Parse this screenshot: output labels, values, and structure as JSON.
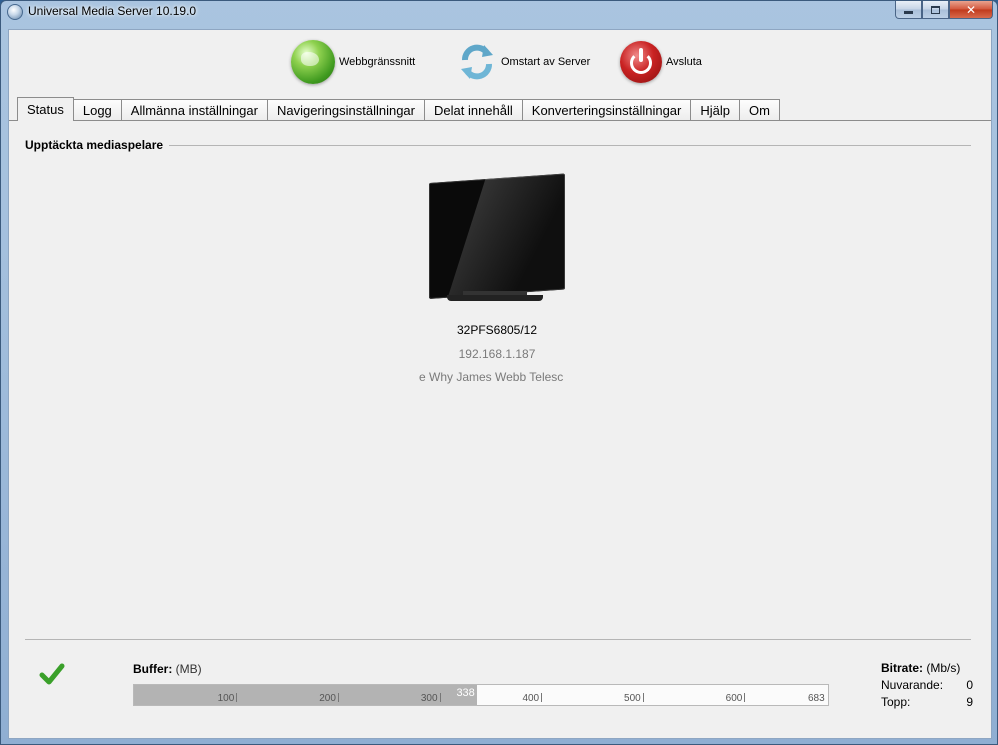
{
  "window": {
    "title": "Universal Media Server 10.19.0",
    "minimize": "minimize",
    "maximize": "maximize",
    "close": "✕"
  },
  "toolbar": {
    "web_label": "Webbgränssnitt",
    "restart_label": "Omstart av Server",
    "quit_label": "Avsluta"
  },
  "tabs": [
    {
      "label": "Status",
      "active": true
    },
    {
      "label": "Logg"
    },
    {
      "label": "Allmänna inställningar"
    },
    {
      "label": "Navigeringsinställningar"
    },
    {
      "label": "Delat innehåll"
    },
    {
      "label": "Konverteringsinställningar"
    },
    {
      "label": "Hjälp"
    },
    {
      "label": "Om"
    }
  ],
  "status": {
    "section_title": "Upptäckta mediaspelare",
    "renderer": {
      "name": "32PFS6805/12",
      "ip": "192.168.1.187",
      "playing": "e   Why James Webb Telesc"
    },
    "buffer": {
      "label": "Buffer:",
      "unit": "(MB)",
      "value": 338,
      "max": 683,
      "value_label": "338",
      "ticks": [
        "100",
        "200",
        "300",
        "400",
        "500",
        "600",
        "683"
      ]
    },
    "bitrate": {
      "label": "Bitrate:",
      "unit": "(Mb/s)",
      "current_label": "Nuvarande:",
      "current_value": "0",
      "peak_label": "Topp:",
      "peak_value": "9"
    }
  },
  "colors": {
    "check": "#3aa02a",
    "buffer_fill": "#b3b3b3"
  }
}
